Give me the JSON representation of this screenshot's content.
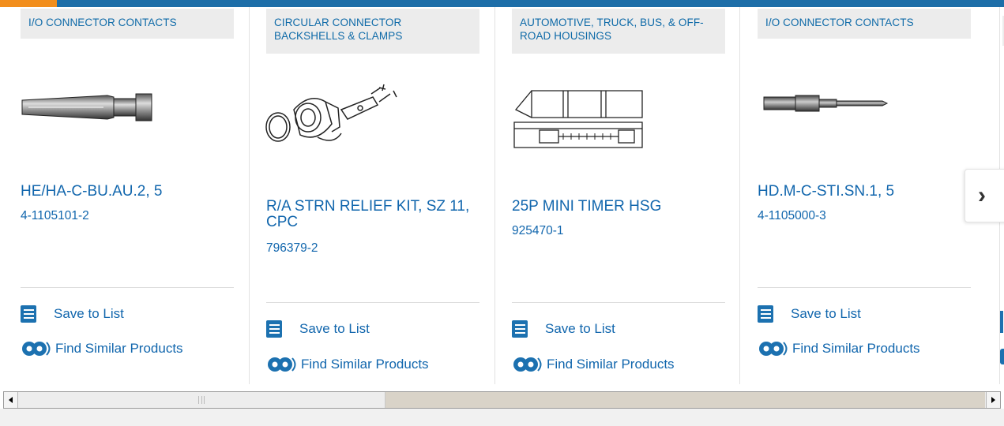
{
  "colors": {
    "accent": "#f28e1c",
    "brand_blue": "#1d6ea8",
    "link": "#1166ad",
    "tag_bg": "#ececec"
  },
  "products": [
    {
      "category": "I/O CONNECTOR CONTACTS",
      "title": "HE/HA-C-BU.AU.2, 5",
      "part_number": "4-1105101-2",
      "image": "socket-contact-image"
    },
    {
      "category": "CIRCULAR CONNECTOR BACKSHELLS & CLAMPS",
      "title": "R/A STRN RELIEF KIT, SZ 11, CPC",
      "part_number": "796379-2",
      "image": "strain-relief-kit-image"
    },
    {
      "category": "AUTOMOTIVE, TRUCK, BUS, & OFF-ROAD HOUSINGS",
      "title": "25P MINI TIMER HSG",
      "part_number": "925470-1",
      "image": "timer-housing-image"
    },
    {
      "category": "I/O CONNECTOR CONTACTS",
      "title": "HD.M-C-STI.SN.1, 5",
      "part_number": "4-1105000-3",
      "image": "pin-contact-image"
    }
  ],
  "actions": {
    "save_label": "Save to List",
    "save_icon": "checklist-icon",
    "similar_label": "Find Similar Products",
    "similar_icon": "gears-icon"
  },
  "carousel": {
    "next_icon": "chevron-right-icon",
    "next_glyph": "›"
  }
}
